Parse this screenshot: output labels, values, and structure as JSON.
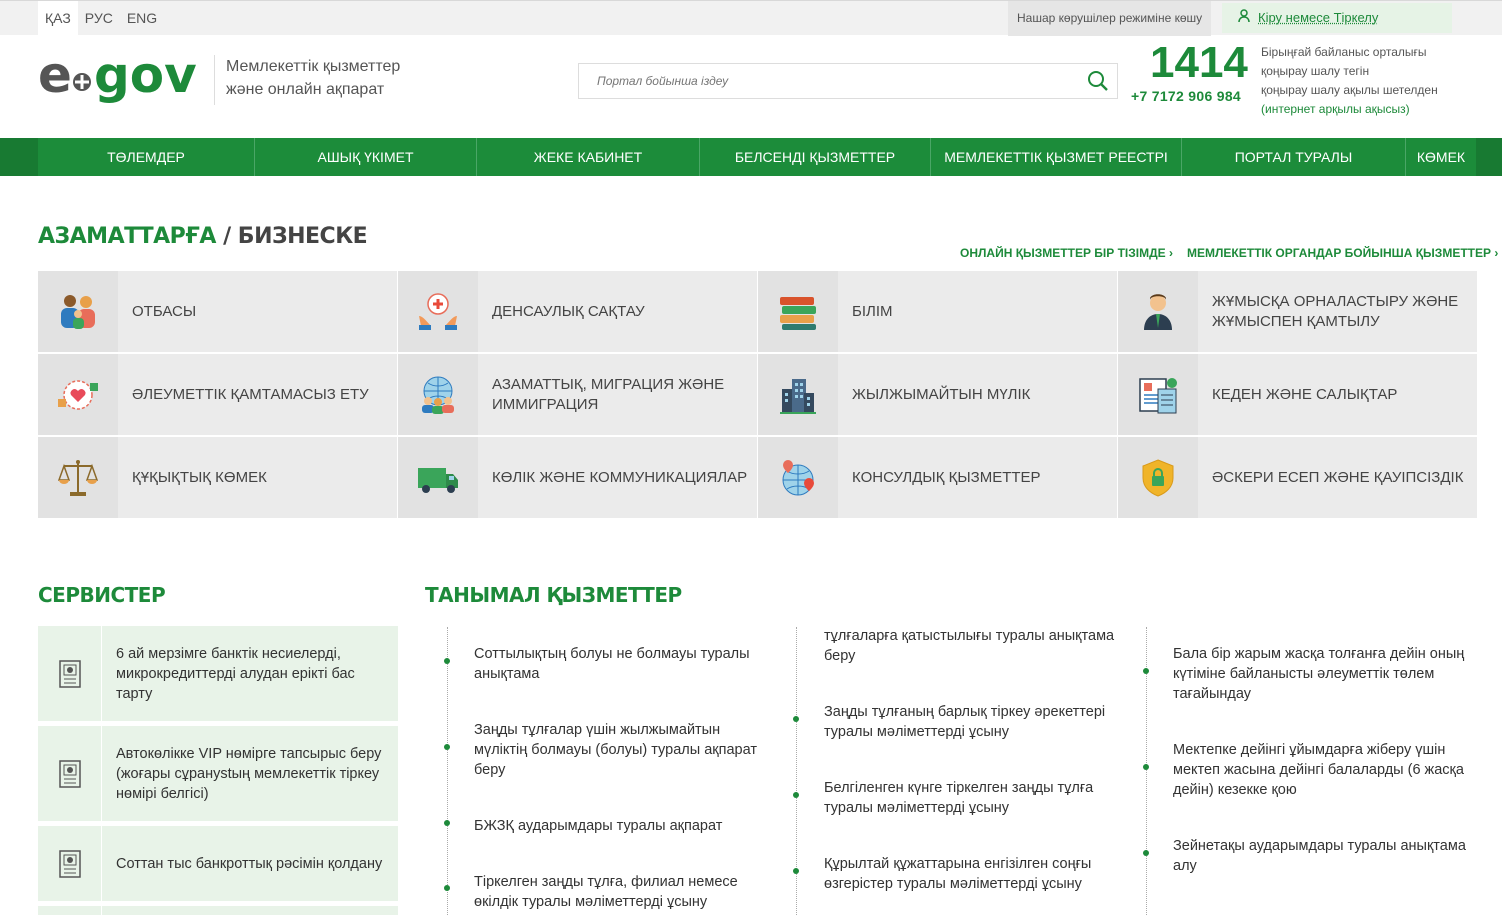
{
  "topbar": {
    "languages": [
      "ҚАЗ",
      "РУС",
      "ENG"
    ],
    "low_vision": "Нашар көрушілер режиміне көшу",
    "login": "Кіру немесе Тіркелу"
  },
  "header": {
    "logo": "egov",
    "tagline": "Мемлекеттік қызметтер және онлайн ақпарат",
    "search_placeholder": "Портал бойынша іздеу",
    "hotline": "1414",
    "phone": "+7 7172 906 984",
    "hotline_info": "Бірыңғай байланыс орталығы қоңырау шалу тегін",
    "phone_info": "қоңырау шалу ақылы шетелден",
    "phone_info_link": "(интернет арқылы ақысыз)"
  },
  "nav": [
    "ТӨЛЕМДЕР",
    "АШЫҚ ҮКІМЕТ",
    "ЖЕКЕ КАБИНЕТ",
    "БЕЛСЕНДІ ҚЫЗМЕТТЕР",
    "МЕМЛЕКЕТТІК ҚЫЗМЕТ РЕЕСТРІ",
    "ПОРТАЛ ТУРАЛЫ",
    "КӨМЕК"
  ],
  "categories_section": {
    "title_citizens": "АЗАМАТТАРҒА",
    "separator": " / ",
    "title_business": "БИЗНЕСКЕ",
    "link_list": "ОНЛАЙН ҚЫЗМЕТТЕР БІР ТІЗІМДЕ",
    "link_agencies": "МЕМЛЕКЕТТІК ОРГАНДАР БОЙЫНША ҚЫЗМЕТТЕР",
    "items": [
      {
        "label": "ОТБАСЫ",
        "icon": "family-icon"
      },
      {
        "label": "ДЕНСАУЛЫҚ САҚТАУ",
        "icon": "health-icon"
      },
      {
        "label": "БІЛІМ",
        "icon": "books-icon"
      },
      {
        "label": "ЖҰМЫСҚА ОРНАЛАСТЫРУ ЖӘНЕ ЖҰМЫСПЕН ҚАМТЫЛУ",
        "icon": "employee-icon"
      },
      {
        "label": "ӘЛЕУМЕТТІК ҚАМТАМАСЫЗ ЕТУ",
        "icon": "social-care-icon"
      },
      {
        "label": "АЗАМАТТЫҚ, МИГРАЦИЯ ЖӘНЕ ИММИГРАЦИЯ",
        "icon": "globe-people-icon"
      },
      {
        "label": "ЖЫЛЖЫМАЙТЫН МҮЛІК",
        "icon": "buildings-icon"
      },
      {
        "label": "КЕДЕН ЖӘНЕ САЛЫҚТАР",
        "icon": "customs-icon"
      },
      {
        "label": "ҚҰҚЫҚТЫҚ КӨМЕК",
        "icon": "scales-icon"
      },
      {
        "label": "КӨЛІК ЖӘНЕ КОММУНИКАЦИЯЛАР",
        "icon": "truck-icon"
      },
      {
        "label": "КОНСУЛДЫҚ ҚЫЗМЕТТЕР",
        "icon": "globe-pin-icon"
      },
      {
        "label": "ӘСКЕРИ ЕСЕП ЖӘНЕ ҚАУІПСІЗДІК",
        "icon": "shield-lock-icon"
      }
    ]
  },
  "services": {
    "title": "СЕРВИСТЕР",
    "items": [
      "6 ай мерзімге банктік несиелерді, микрокредиттерді алудан ерікті бас тарту",
      "Автокөлікке VIP нөмірге тапсырыс беру (жоғары сұранystың мемлекеттік тіркеу нөмірі белгісі)",
      "Соттан тыс банкроттық рәсімін қолдану"
    ]
  },
  "popular": {
    "title": "ТАНЫМАЛ ҚЫЗМЕТТЕР",
    "col1": [
      "Соттылықтың болуы не болмауы туралы анықтама",
      "Заңды тұлғалар үшін жылжымайтын мүліктің болмауы (болуы) туралы ақпарат беру",
      "БЖЗҚ аударымдары туралы ақпарат",
      "Тіркелген заңды тұлға, филиал немесе өкілдік туралы мәліметтерді ұсыну"
    ],
    "col2": [
      "тұлғаларға қатыстылығы туралы анықтама беру",
      "Заңды тұлғаның барлық тіркеу әрекеттері туралы мәліметтерді ұсыну",
      "Белгіленген күнге тіркелген заңды тұлға туралы мәліметтерді ұсыну",
      "Құрылтай құжаттарына енгізілген соңғы өзгерістер туралы мәліметтерді ұсыну"
    ],
    "col3": [
      "Бала бір жарым жасқа толғанға дейін оның күтіміне байланысты әлеуметтік төлем тағайындау",
      "Мектепке дейінгі ұйымдарға жіберу үшін мектеп жасына дейінгі балаларды (6 жасқа дейін) кезекке қою",
      "Зейнетақы аударымдары туралы анықтама алу"
    ]
  },
  "colors": {
    "brand": "#1d8a3a",
    "nav": "#1c8c3a"
  }
}
